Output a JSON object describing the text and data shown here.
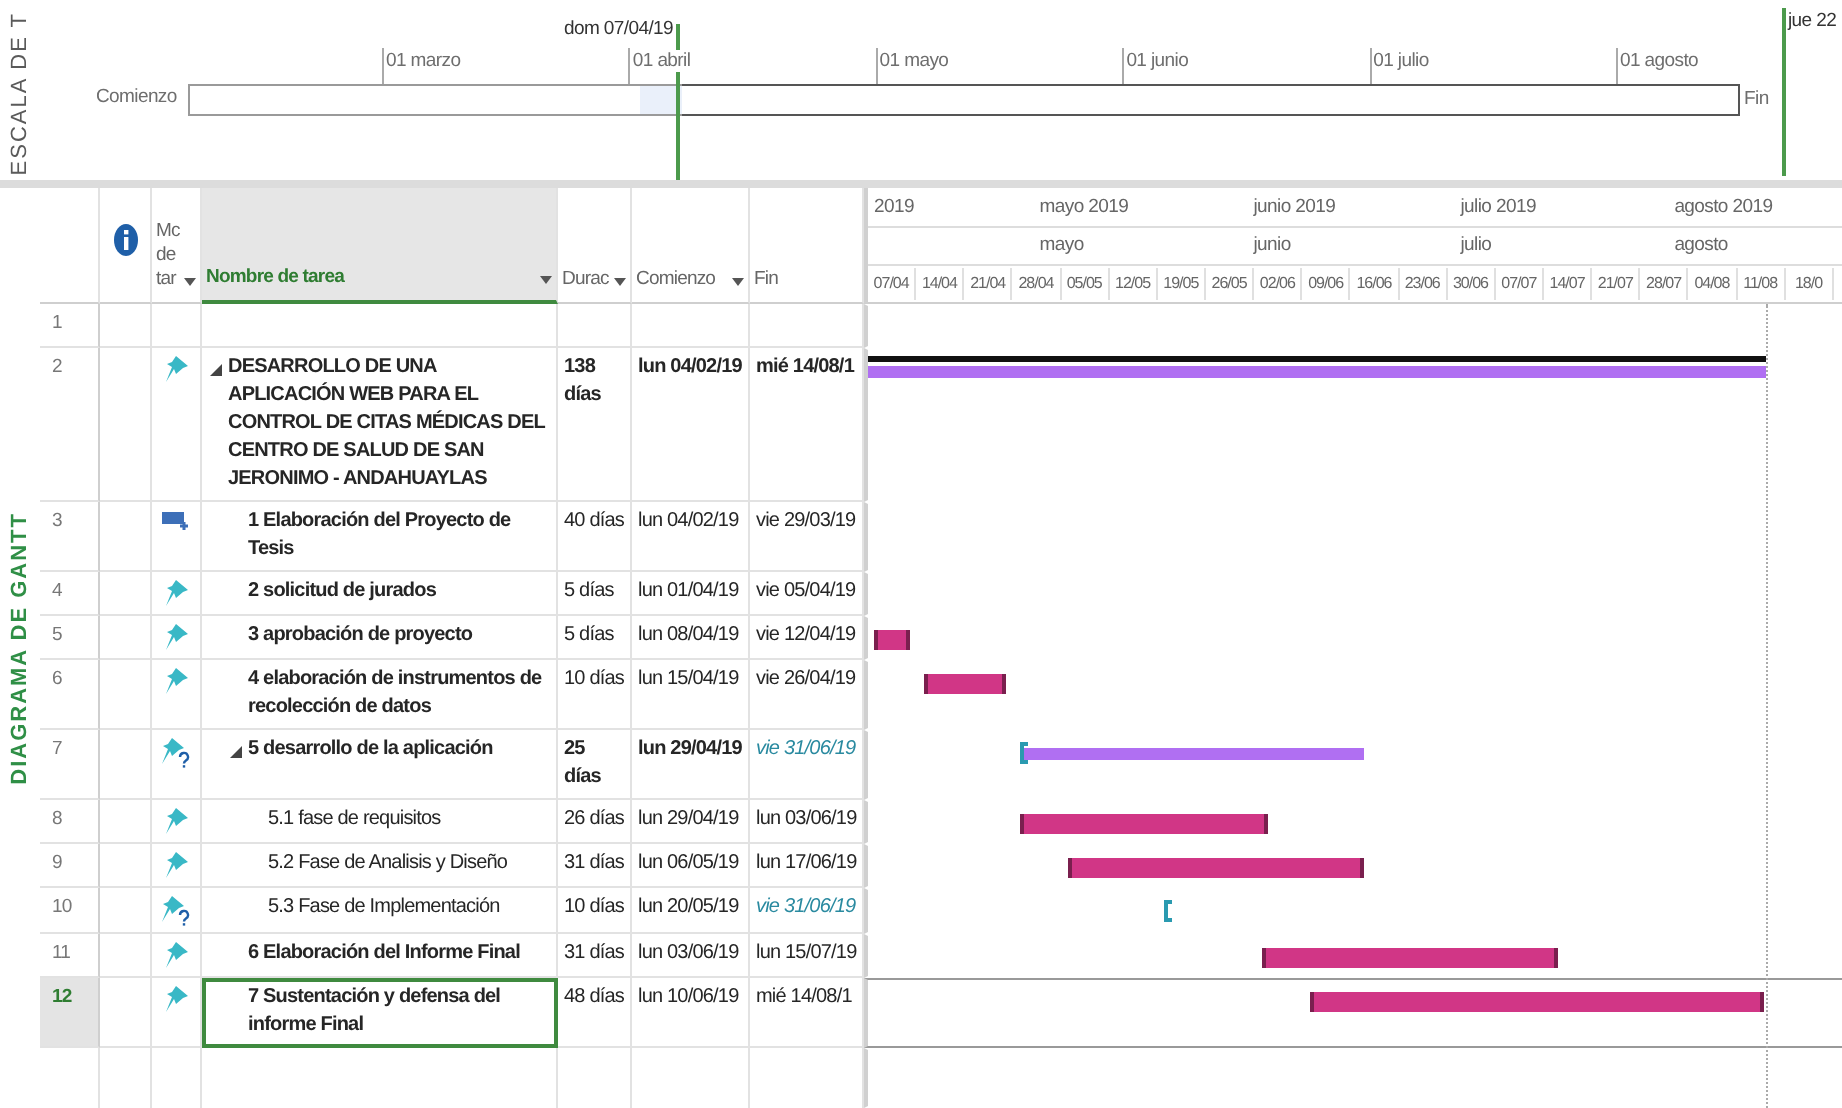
{
  "timeline": {
    "side_label": "ESCALA DE T",
    "today_label": "dom 07/04/19",
    "end_label": "jue 22",
    "start_label": "Comienzo",
    "finish_label": "Fin",
    "months": [
      "01 marzo",
      "01 abril",
      "01 mayo",
      "01 junio",
      "01 julio",
      "01 agosto"
    ]
  },
  "view_label": "DIAGRAMA DE GANTT",
  "columns": [
    {
      "kind": "info",
      "filter": false,
      "selected": false
    },
    {
      "kind": "mode",
      "label": "Mc de tar",
      "filter": true,
      "selected": false
    },
    {
      "kind": "name",
      "label": "Nombre de tarea",
      "filter": true,
      "selected": true
    },
    {
      "kind": "duration",
      "label": "Durac",
      "filter": true,
      "selected": false
    },
    {
      "kind": "start",
      "label": "Comienzo",
      "filter": true,
      "selected": false
    },
    {
      "kind": "finish",
      "label": "Fin",
      "filter": false,
      "selected": false
    }
  ],
  "gantt_header": {
    "top_months": [
      "2019",
      "mayo 2019",
      "junio 2019",
      "julio 2019",
      "agosto 2019"
    ],
    "months": [
      "mayo",
      "junio",
      "julio",
      "agosto"
    ],
    "weeks": [
      "07/04",
      "14/04",
      "21/04",
      "28/04",
      "05/05",
      "12/05",
      "19/05",
      "26/05",
      "02/06",
      "09/06",
      "16/06",
      "23/06",
      "30/06",
      "07/07",
      "14/07",
      "21/07",
      "28/07",
      "04/08",
      "11/08",
      "18/0"
    ]
  },
  "rows": [
    {
      "row_number": "1",
      "selected": false
    },
    {
      "row_number": "2",
      "kind": "project_summary",
      "name": "DESARROLLO DE UNA APLICACIÓN WEB PARA EL CONTROL DE CITAS MÉDICAS DEL CENTRO DE SALUD DE SAN JERONIMO - ANDAHUAYLAS",
      "duration": "138 días",
      "start": "lun 04/02/19",
      "finish": "mié 14/08/1",
      "expanded": true,
      "selected": false,
      "children": [
        {
          "row_number": "3",
          "kind": "note_task",
          "name": "1 Elaboración del Proyecto de Tesis",
          "duration": "40 días",
          "start": "lun 04/02/19",
          "finish": "vie 29/03/19",
          "selected": false
        },
        {
          "row_number": "4",
          "kind": "task",
          "name": "2 solicitud de jurados",
          "duration": "5 días",
          "start": "lun 01/04/19",
          "finish": "vie 05/04/19",
          "selected": false
        },
        {
          "row_number": "5",
          "kind": "task",
          "name": "3 aprobación de proyecto",
          "duration": "5 días",
          "start": "lun 08/04/19",
          "finish": "vie 12/04/19",
          "selected": false
        },
        {
          "row_number": "6",
          "kind": "task",
          "name": "4 elaboración de instrumentos de recolección de datos",
          "duration": "10 días",
          "start": "lun 15/04/19",
          "finish": "vie 26/04/19",
          "selected": false
        },
        {
          "row_number": "7",
          "kind": "manual_summary",
          "name": "5 desarrollo de la aplicación",
          "duration": "25 días",
          "start": "lun 29/04/19",
          "finish": "vie 31/06/19",
          "expanded": true,
          "selected": false,
          "children": [
            {
              "row_number": "8",
              "kind": "task",
              "name": "5.1 fase de requisitos",
              "duration": "26 días",
              "start": "lun 29/04/19",
              "finish": "lun 03/06/19",
              "selected": false
            },
            {
              "row_number": "9",
              "kind": "task",
              "name": "5.2 Fase de Analisis y Diseño",
              "duration": "31 días",
              "start": "lun 06/05/19",
              "finish": "lun 17/06/19",
              "selected": false
            },
            {
              "row_number": "10",
              "kind": "manual_task",
              "name": "5.3 Fase de Implementación",
              "duration": "10 días",
              "start": "lun 20/05/19",
              "finish": "vie 31/06/19",
              "selected": false
            }
          ]
        },
        {
          "row_number": "11",
          "kind": "task",
          "name": "6 Elaboración del Informe Final",
          "duration": "31 días",
          "start": "lun 03/06/19",
          "finish": "lun 15/07/19",
          "selected": false
        },
        {
          "row_number": "12",
          "kind": "task",
          "name": "7 Sustentación y defensa del informe Final",
          "duration": "48 días",
          "start": "lun 10/06/19",
          "finish": "mié 14/08/1",
          "selected": true
        }
      ]
    }
  ]
}
